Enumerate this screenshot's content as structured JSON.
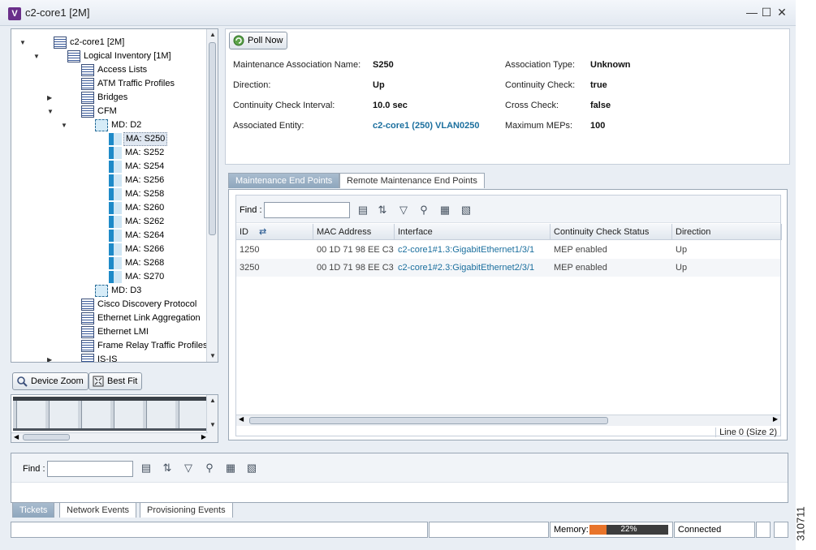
{
  "window": {
    "title": "c2-core1 [2M]"
  },
  "tree": {
    "nodes": [
      {
        "label": "c2-core1 [2M]",
        "indent": 0,
        "twisty": "▼",
        "icon": "device-icon"
      },
      {
        "label": "Logical Inventory [1M]",
        "indent": 1,
        "twisty": "▼",
        "icon": "inventory-icon"
      },
      {
        "label": "Access Lists",
        "indent": 2,
        "twisty": "",
        "icon": "table-icon"
      },
      {
        "label": "ATM Traffic Profiles",
        "indent": 2,
        "twisty": "",
        "icon": "table-icon"
      },
      {
        "label": "Bridges",
        "indent": 2,
        "twisty": "▶",
        "icon": "table-icon"
      },
      {
        "label": "CFM",
        "indent": 2,
        "twisty": "▼",
        "icon": "cfm-icon"
      },
      {
        "label": "MD: D2",
        "indent": 3,
        "twisty": "▼",
        "icon": "md-icon"
      },
      {
        "label": "MA: S250",
        "indent": 4,
        "twisty": "",
        "icon": "ma-icon",
        "selected": true
      },
      {
        "label": "MA: S252",
        "indent": 4,
        "twisty": "",
        "icon": "ma-icon"
      },
      {
        "label": "MA: S254",
        "indent": 4,
        "twisty": "",
        "icon": "ma-icon"
      },
      {
        "label": "MA: S256",
        "indent": 4,
        "twisty": "",
        "icon": "ma-icon"
      },
      {
        "label": "MA: S258",
        "indent": 4,
        "twisty": "",
        "icon": "ma-icon"
      },
      {
        "label": "MA: S260",
        "indent": 4,
        "twisty": "",
        "icon": "ma-icon"
      },
      {
        "label": "MA: S262",
        "indent": 4,
        "twisty": "",
        "icon": "ma-icon"
      },
      {
        "label": "MA: S264",
        "indent": 4,
        "twisty": "",
        "icon": "ma-icon"
      },
      {
        "label": "MA: S266",
        "indent": 4,
        "twisty": "",
        "icon": "ma-icon"
      },
      {
        "label": "MA: S268",
        "indent": 4,
        "twisty": "",
        "icon": "ma-icon"
      },
      {
        "label": "MA: S270",
        "indent": 4,
        "twisty": "",
        "icon": "ma-icon"
      },
      {
        "label": "MD: D3",
        "indent": 3,
        "twisty": "",
        "icon": "md-icon"
      },
      {
        "label": "Cisco Discovery Protocol",
        "indent": 2,
        "twisty": "",
        "icon": "table-icon"
      },
      {
        "label": "Ethernet Link Aggregation",
        "indent": 2,
        "twisty": "",
        "icon": "table-icon"
      },
      {
        "label": "Ethernet LMI",
        "indent": 2,
        "twisty": "",
        "icon": "table-icon"
      },
      {
        "label": "Frame Relay Traffic Profiles",
        "indent": 2,
        "twisty": "",
        "icon": "table-icon"
      },
      {
        "label": "IS-IS",
        "indent": 2,
        "twisty": "▶",
        "icon": "table-icon"
      }
    ]
  },
  "device_view": {
    "zoom_label": "Device Zoom",
    "best_fit_label": "Best Fit"
  },
  "properties": {
    "poll_now": "Poll Now",
    "left": [
      {
        "label": "Maintenance Association Name:",
        "value": "S250",
        "link": false
      },
      {
        "label": "Direction:",
        "value": "Up",
        "link": false
      },
      {
        "label": "Continuity Check Interval:",
        "value": "10.0 sec",
        "link": false
      },
      {
        "label": "Associated Entity:",
        "value": "c2-core1 (250) VLAN0250",
        "link": true
      }
    ],
    "right": [
      {
        "label": "Association Type:",
        "value": "Unknown"
      },
      {
        "label": "Continuity Check:",
        "value": "true"
      },
      {
        "label": "Cross Check:",
        "value": "false"
      },
      {
        "label": "Maximum MEPs:",
        "value": "100"
      }
    ]
  },
  "tabs": {
    "mep": "Maintenance End Points",
    "remote": "Remote Maintenance End Points"
  },
  "mep_table": {
    "find_label": "Find :",
    "find_value": "",
    "columns": [
      "ID",
      "MAC Address",
      "Interface",
      "Continuity Check Status",
      "Direction"
    ],
    "rows": [
      [
        "1250",
        "00 1D 71 98 EE C3",
        "c2-core1#1.3:GigabitEthernet1/3/1",
        "MEP enabled",
        "Up"
      ],
      [
        "3250",
        "00 1D 71 98 EE C3",
        "c2-core1#2.3:GigabitEthernet2/3/1",
        "MEP enabled",
        "Up"
      ]
    ],
    "status": "Line 0 (Size 2)"
  },
  "tickets": {
    "find_label": "Find :",
    "find_value": ""
  },
  "bottom_tabs": {
    "tickets": "Tickets",
    "network": "Network Events",
    "provisioning": "Provisioning Events"
  },
  "statusbar": {
    "memory_label": "Memory:",
    "memory_percent": "22%",
    "memory_fraction": 0.22,
    "connection": "Connected"
  },
  "side_code": "310711"
}
